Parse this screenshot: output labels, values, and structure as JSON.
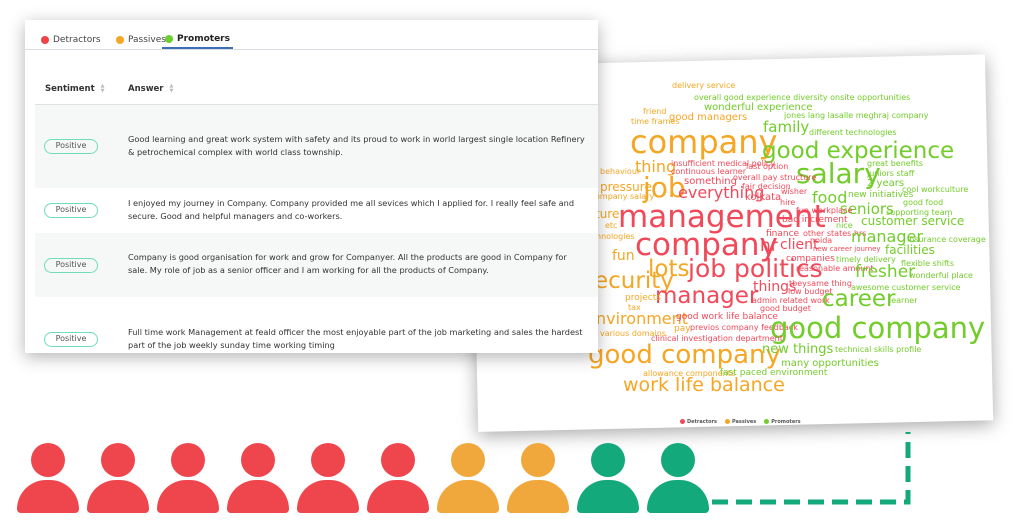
{
  "colors": {
    "detractors": "#f0495a",
    "passives": "#f5a623",
    "promoters": "#72cc2a",
    "tab_underline": "#3c6eb4",
    "badge_border": "#6fdcbc",
    "person_red": "#ef464d",
    "person_orange": "#f0a83c",
    "person_green": "#13a97a"
  },
  "tabs": [
    {
      "label": "Detractors",
      "dot": "#f04444"
    },
    {
      "label": "Passives",
      "dot": "#f5a623"
    },
    {
      "label": "Promoters",
      "dot": "#6ccf2e",
      "active": true
    }
  ],
  "table": {
    "headers": [
      "Sentiment",
      "Answer"
    ],
    "rows": [
      {
        "sentiment": "Positive",
        "answer": "Good learning and great work system with safety and its proud to work in world largest single location Refinery & petrochemical complex with world class township."
      },
      {
        "sentiment": "Positive",
        "answer": "I enjoyed my journey in Company. Company provided me all sevices which I applied for. I really feel safe and secure. Good and helpful managers and co-workers."
      },
      {
        "sentiment": "Positive",
        "answer": "Company is good organisation for work and grow for Companyer. All the products are good in Company for sale. My role of job as a senior officer and I am working for all the products of Company."
      },
      {
        "sentiment": "Positive",
        "answer": "Full time work Management at feald officer the most enjoyable part of the job marketing and sales the hardest part of the job weekly sunday time working timing"
      }
    ]
  },
  "word_cloud": {
    "words": [
      {
        "text": "delivery service",
        "group": "O"
      },
      {
        "text": "overall good experience diversity onsite opportunities",
        "group": "G"
      },
      {
        "text": "wonderful experience",
        "group": "G"
      },
      {
        "text": "friend",
        "group": "O"
      },
      {
        "text": "jones lang lasalle meghraj company",
        "group": "G"
      },
      {
        "text": "time frames",
        "group": "O"
      },
      {
        "text": "good managers",
        "group": "O"
      },
      {
        "text": "family",
        "group": "G"
      },
      {
        "text": "different technologies",
        "group": "G"
      },
      {
        "text": "company",
        "group": "O"
      },
      {
        "text": "good experience",
        "group": "G"
      },
      {
        "text": "thing",
        "group": "O"
      },
      {
        "text": "insufficient medical policy",
        "group": "R"
      },
      {
        "text": "last option",
        "group": "R"
      },
      {
        "text": "great benefits",
        "group": "G"
      },
      {
        "text": "continuous learner",
        "group": "R"
      },
      {
        "text": "salary",
        "group": "G"
      },
      {
        "text": "juniors staff",
        "group": "G"
      },
      {
        "text": "overall pay structure",
        "group": "R"
      },
      {
        "text": "something",
        "group": "R"
      },
      {
        "text": "2 years",
        "group": "G"
      },
      {
        "text": "job",
        "group": "O"
      },
      {
        "text": "pressure",
        "group": "O"
      },
      {
        "text": "fair decision",
        "group": "R"
      },
      {
        "text": "everything",
        "group": "R"
      },
      {
        "text": "wisher",
        "group": "R"
      },
      {
        "text": "cool workculture",
        "group": "G"
      },
      {
        "text": "ompany salary",
        "group": "O"
      },
      {
        "text": "kolkata",
        "group": "R"
      },
      {
        "text": "food",
        "group": "G"
      },
      {
        "text": "new initiatives",
        "group": "G"
      },
      {
        "text": "hire",
        "group": "R"
      },
      {
        "text": "good food",
        "group": "G"
      },
      {
        "text": "management",
        "group": "R"
      },
      {
        "text": "seniors",
        "group": "G"
      },
      {
        "text": "fun workplace",
        "group": "R"
      },
      {
        "text": "supporting team",
        "group": "G"
      },
      {
        "text": "bad increment",
        "group": "R"
      },
      {
        "text": "customer service",
        "group": "G"
      },
      {
        "text": "nice",
        "group": "G"
      },
      {
        "text": "finance",
        "group": "R"
      },
      {
        "text": "other states hrs",
        "group": "R"
      },
      {
        "text": "manager",
        "group": "G"
      },
      {
        "text": "insurance coverage",
        "group": "G"
      },
      {
        "text": "noida",
        "group": "R"
      },
      {
        "text": "company",
        "group": "R"
      },
      {
        "text": "hr",
        "group": "R"
      },
      {
        "text": "client",
        "group": "R"
      },
      {
        "text": "new career journey",
        "group": "R"
      },
      {
        "text": "facilities",
        "group": "G"
      },
      {
        "text": "hnologies",
        "group": "O"
      },
      {
        "text": "fun",
        "group": "O"
      },
      {
        "text": "companies",
        "group": "R"
      },
      {
        "text": "timely delivery",
        "group": "G"
      },
      {
        "text": "flexible shifts",
        "group": "G"
      },
      {
        "text": "lots",
        "group": "O"
      },
      {
        "text": "job politics",
        "group": "R"
      },
      {
        "text": "reasonable amount",
        "group": "R"
      },
      {
        "text": "fresher",
        "group": "G"
      },
      {
        "text": "wonderful place",
        "group": "G"
      },
      {
        "text": "ecurity",
        "group": "O"
      },
      {
        "text": "things",
        "group": "R"
      },
      {
        "text": "tbey",
        "group": "R"
      },
      {
        "text": "same thing",
        "group": "R"
      },
      {
        "text": "awesome customer service",
        "group": "G"
      },
      {
        "text": "low budget",
        "group": "R"
      },
      {
        "text": "manager",
        "group": "R"
      },
      {
        "text": "projects",
        "group": "O"
      },
      {
        "text": "admin related work",
        "group": "R"
      },
      {
        "text": "career",
        "group": "G"
      },
      {
        "text": "learner",
        "group": "G"
      },
      {
        "text": "tax",
        "group": "O"
      },
      {
        "text": "good budget",
        "group": "R"
      },
      {
        "text": "nvironment",
        "group": "O"
      },
      {
        "text": "good work life balance",
        "group": "R"
      },
      {
        "text": "pay",
        "group": "O"
      },
      {
        "text": "previos company feedback",
        "group": "R"
      },
      {
        "text": "good company",
        "group": "G"
      },
      {
        "text": "various domains",
        "group": "O"
      },
      {
        "text": "clinical investigation department",
        "group": "R"
      },
      {
        "text": "good company",
        "group": "O"
      },
      {
        "text": "new things",
        "group": "G"
      },
      {
        "text": "technical skills profile",
        "group": "G"
      },
      {
        "text": "many opportunities",
        "group": "G"
      },
      {
        "text": "allowance components",
        "group": "O"
      },
      {
        "text": "fast paced environment",
        "group": "G"
      },
      {
        "text": "work life balance",
        "group": "O"
      },
      {
        "text": "behaviour",
        "group": "O"
      },
      {
        "text": "etc",
        "group": "O"
      },
      {
        "text": "ture",
        "group": "O"
      }
    ],
    "legend": [
      {
        "label": "Detractors",
        "color": "#f0495a"
      },
      {
        "label": "Passives",
        "color": "#f5a623"
      },
      {
        "label": "Promoters",
        "color": "#72cc2a"
      }
    ]
  },
  "people": [
    "red",
    "red",
    "red",
    "red",
    "red",
    "red",
    "orange",
    "orange",
    "green",
    "green"
  ],
  "connector": {
    "style": "dashed",
    "color": "#13a97a"
  }
}
